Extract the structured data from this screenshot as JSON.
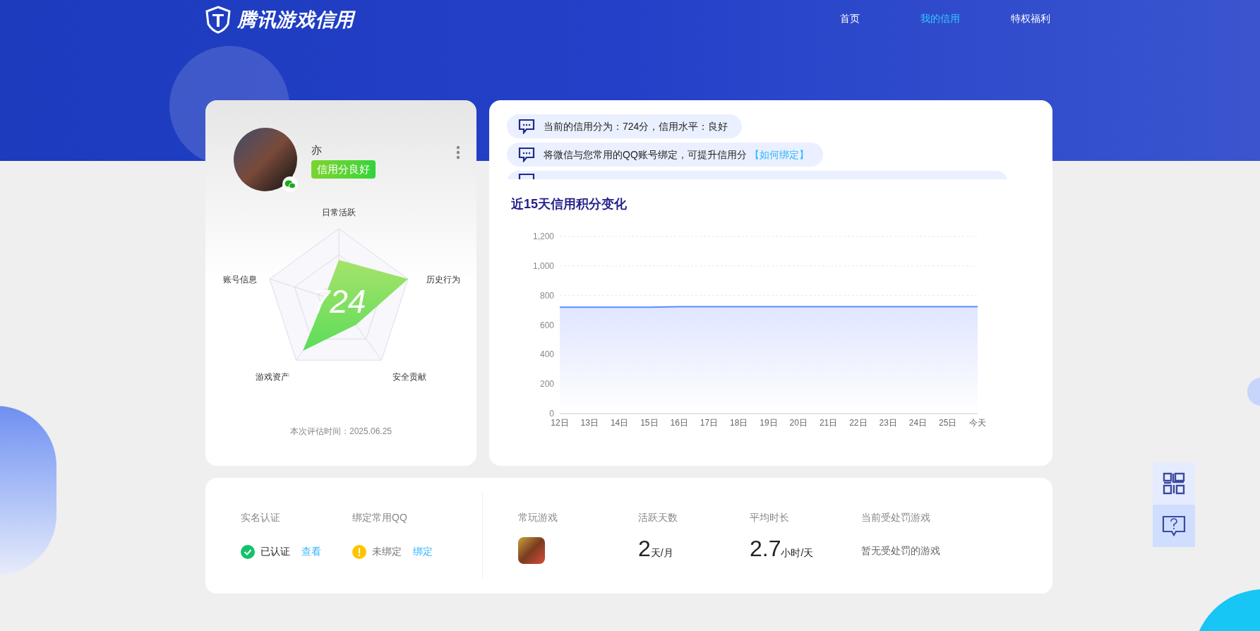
{
  "header": {
    "logo_text": "腾讯游戏信用",
    "nav": [
      {
        "label": "首页",
        "selected": false
      },
      {
        "label": "我的信用",
        "selected": true
      },
      {
        "label": "特权福利",
        "selected": false
      }
    ]
  },
  "profile": {
    "name": "亦",
    "badge": "信用分良好",
    "score": "724",
    "radar_labels": [
      "日常活跃",
      "历史行为",
      "安全贡献",
      "游戏资产",
      "账号信息"
    ],
    "eval_time": "本次评估时间：2025.06.25"
  },
  "messages": [
    {
      "text": "当前的信用分为：724分，信用水平：良好"
    },
    {
      "text": "将微信与您常用的QQ账号绑定，可提升信用分",
      "link": "【如何绑定】"
    }
  ],
  "chart": {
    "title": "近15天信用积分变化",
    "chart_data": {
      "type": "area",
      "categories": [
        "12日",
        "13日",
        "14日",
        "15日",
        "16日",
        "17日",
        "18日",
        "19日",
        "20日",
        "21日",
        "22日",
        "23日",
        "24日",
        "25日",
        "今天"
      ],
      "series": [
        {
          "color": "#5b8cff",
          "values": [
            721,
            721,
            721,
            721,
            724,
            724,
            724,
            724,
            724,
            724,
            724,
            724,
            724,
            724,
            724
          ]
        }
      ],
      "ylim": [
        0,
        1200
      ],
      "yticks": [
        0,
        {
          "value": 200,
          "label": "200"
        },
        {
          "value": 400,
          "label": "400"
        },
        {
          "value": 600,
          "label": "600"
        },
        {
          "value": 800,
          "label": "800"
        },
        {
          "value": 1000,
          "label": "1,000"
        },
        {
          "value": 1200,
          "label": "1,200"
        }
      ]
    }
  },
  "account": [
    {
      "label": "实名认证",
      "kind": "ok",
      "status": "已认证",
      "action": "查看"
    },
    {
      "label": "绑定常用QQ",
      "kind": "warn",
      "status": "未绑定",
      "action": "绑定"
    }
  ],
  "games": {
    "label": "常玩游戏"
  },
  "stats": [
    {
      "label": "活跃天数",
      "value": "2",
      "unit": "天/月"
    },
    {
      "label": "平均时长",
      "value": "2.7",
      "unit": "小时/天"
    }
  ],
  "penalty": {
    "label": "当前受处罚游戏",
    "text": "暂无受处罚的游戏"
  }
}
